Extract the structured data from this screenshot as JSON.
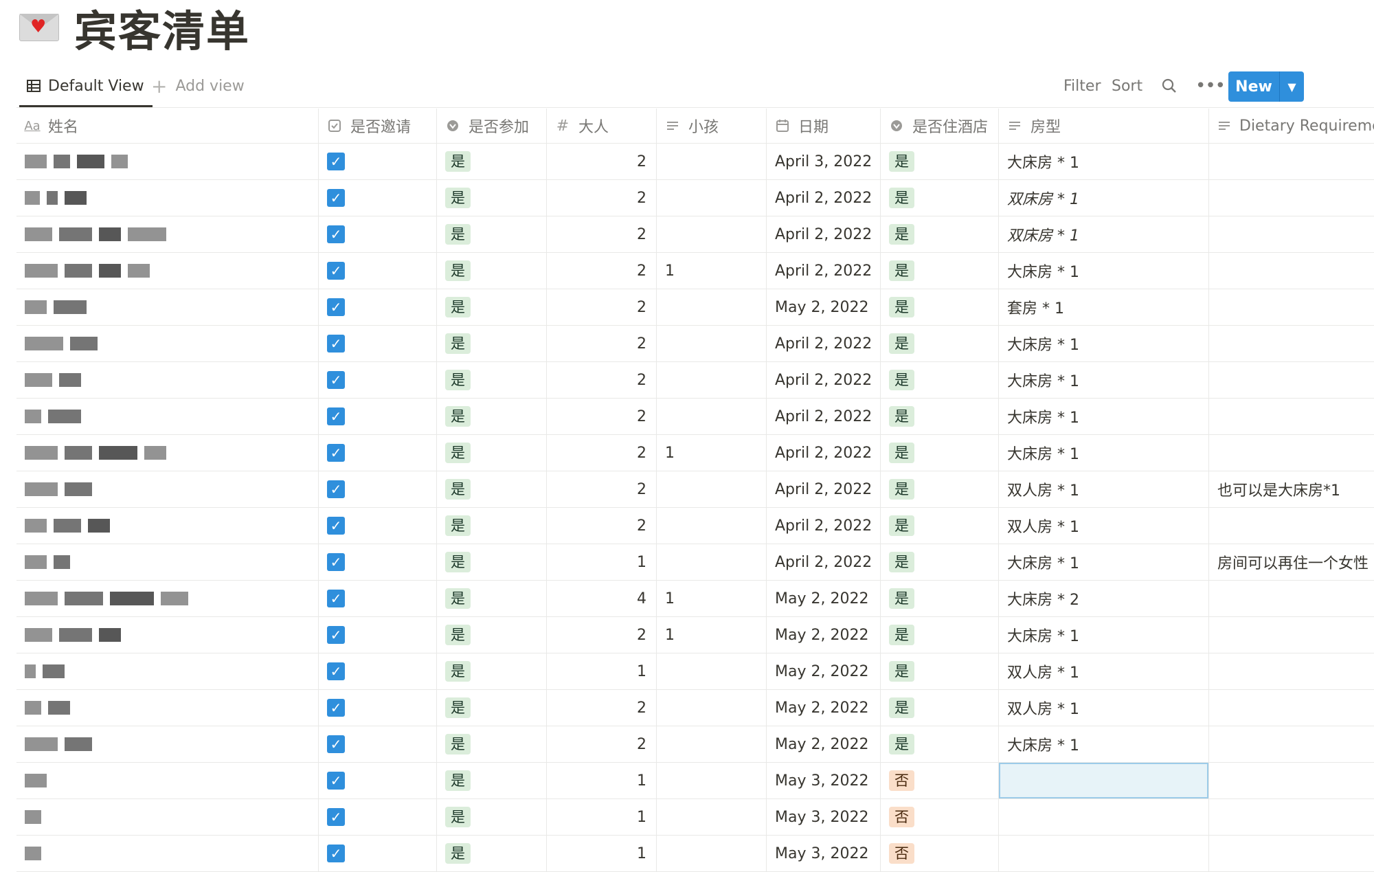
{
  "page": {
    "title": "宾客清单",
    "icon": "love-letter-icon"
  },
  "viewbar": {
    "default_view": "Default View",
    "add_view": "Add view",
    "filter": "Filter",
    "sort": "Sort",
    "new": "New",
    "accent": "#2f8fdc"
  },
  "columns": [
    {
      "label": "姓名",
      "icon": "title-aa-icon"
    },
    {
      "label": "是否邀请",
      "icon": "checkbox-icon"
    },
    {
      "label": "是否参加",
      "icon": "select-icon"
    },
    {
      "label": "大人",
      "icon": "number-hash-icon"
    },
    {
      "label": "小孩",
      "icon": "text-lines-icon"
    },
    {
      "label": "日期",
      "icon": "calendar-icon"
    },
    {
      "label": "是否住酒店",
      "icon": "select-icon"
    },
    {
      "label": "房型",
      "icon": "text-lines-icon"
    },
    {
      "label": "Dietary Requiremen",
      "icon": "text-lines-icon"
    }
  ],
  "rows": [
    {
      "invited": true,
      "attend": "是",
      "adults": "2",
      "kids": "",
      "date": "April 3, 2022",
      "hotel": "是",
      "room": "大床房 * 1",
      "dietary": ""
    },
    {
      "invited": true,
      "attend": "是",
      "adults": "2",
      "kids": "",
      "date": "April 2, 2022",
      "hotel": "是",
      "room": "双床房 * 1",
      "dietary": ""
    },
    {
      "invited": true,
      "attend": "是",
      "adults": "2",
      "kids": "",
      "date": "April 2, 2022",
      "hotel": "是",
      "room": "双床房 * 1",
      "dietary": ""
    },
    {
      "invited": true,
      "attend": "是",
      "adults": "2",
      "kids": "1",
      "date": "April 2, 2022",
      "hotel": "是",
      "room": "大床房 * 1",
      "dietary": ""
    },
    {
      "invited": true,
      "attend": "是",
      "adults": "2",
      "kids": "",
      "date": "May 2, 2022",
      "hotel": "是",
      "room": "套房 * 1",
      "dietary": ""
    },
    {
      "invited": true,
      "attend": "是",
      "adults": "2",
      "kids": "",
      "date": "April 2, 2022",
      "hotel": "是",
      "room": "大床房 * 1",
      "dietary": ""
    },
    {
      "invited": true,
      "attend": "是",
      "adults": "2",
      "kids": "",
      "date": "April 2, 2022",
      "hotel": "是",
      "room": "大床房 * 1",
      "dietary": ""
    },
    {
      "invited": true,
      "attend": "是",
      "adults": "2",
      "kids": "",
      "date": "April 2, 2022",
      "hotel": "是",
      "room": "大床房 * 1",
      "dietary": ""
    },
    {
      "invited": true,
      "attend": "是",
      "adults": "2",
      "kids": "1",
      "date": "April 2, 2022",
      "hotel": "是",
      "room": "大床房 * 1",
      "dietary": ""
    },
    {
      "invited": true,
      "attend": "是",
      "adults": "2",
      "kids": "",
      "date": "April 2, 2022",
      "hotel": "是",
      "room": "双人房 * 1",
      "dietary": "也可以是大床房*1"
    },
    {
      "invited": true,
      "attend": "是",
      "adults": "2",
      "kids": "",
      "date": "April 2, 2022",
      "hotel": "是",
      "room": "双人房 * 1",
      "dietary": ""
    },
    {
      "invited": true,
      "attend": "是",
      "adults": "1",
      "kids": "",
      "date": "April 2, 2022",
      "hotel": "是",
      "room": "大床房 * 1",
      "dietary": "房间可以再住一个女性"
    },
    {
      "invited": true,
      "attend": "是",
      "adults": "4",
      "kids": "1",
      "date": "May 2, 2022",
      "hotel": "是",
      "room": "大床房 * 2",
      "dietary": ""
    },
    {
      "invited": true,
      "attend": "是",
      "adults": "2",
      "kids": "1",
      "date": "May 2, 2022",
      "hotel": "是",
      "room": "大床房 * 1",
      "dietary": ""
    },
    {
      "invited": true,
      "attend": "是",
      "adults": "1",
      "kids": "",
      "date": "May 2, 2022",
      "hotel": "是",
      "room": "双人房 * 1",
      "dietary": ""
    },
    {
      "invited": true,
      "attend": "是",
      "adults": "2",
      "kids": "",
      "date": "May 2, 2022",
      "hotel": "是",
      "room": "双人房 * 1",
      "dietary": ""
    },
    {
      "invited": true,
      "attend": "是",
      "adults": "2",
      "kids": "",
      "date": "May 2, 2022",
      "hotel": "是",
      "room": "大床房 * 1",
      "dietary": ""
    },
    {
      "invited": true,
      "attend": "是",
      "adults": "1",
      "kids": "",
      "date": "May 3, 2022",
      "hotel": "否",
      "room": "",
      "dietary": ""
    },
    {
      "invited": true,
      "attend": "是",
      "adults": "1",
      "kids": "",
      "date": "May 3, 2022",
      "hotel": "否",
      "room": "",
      "dietary": ""
    },
    {
      "invited": true,
      "attend": "是",
      "adults": "1",
      "kids": "",
      "date": "May 3, 2022",
      "hotel": "否",
      "room": "",
      "dietary": ""
    }
  ],
  "colors": {
    "tag_yes_bg": "#dbeddb",
    "tag_no_bg": "#fadec9",
    "checkbox": "#2f8fdc",
    "selected_cell": "#e7f3f8"
  }
}
